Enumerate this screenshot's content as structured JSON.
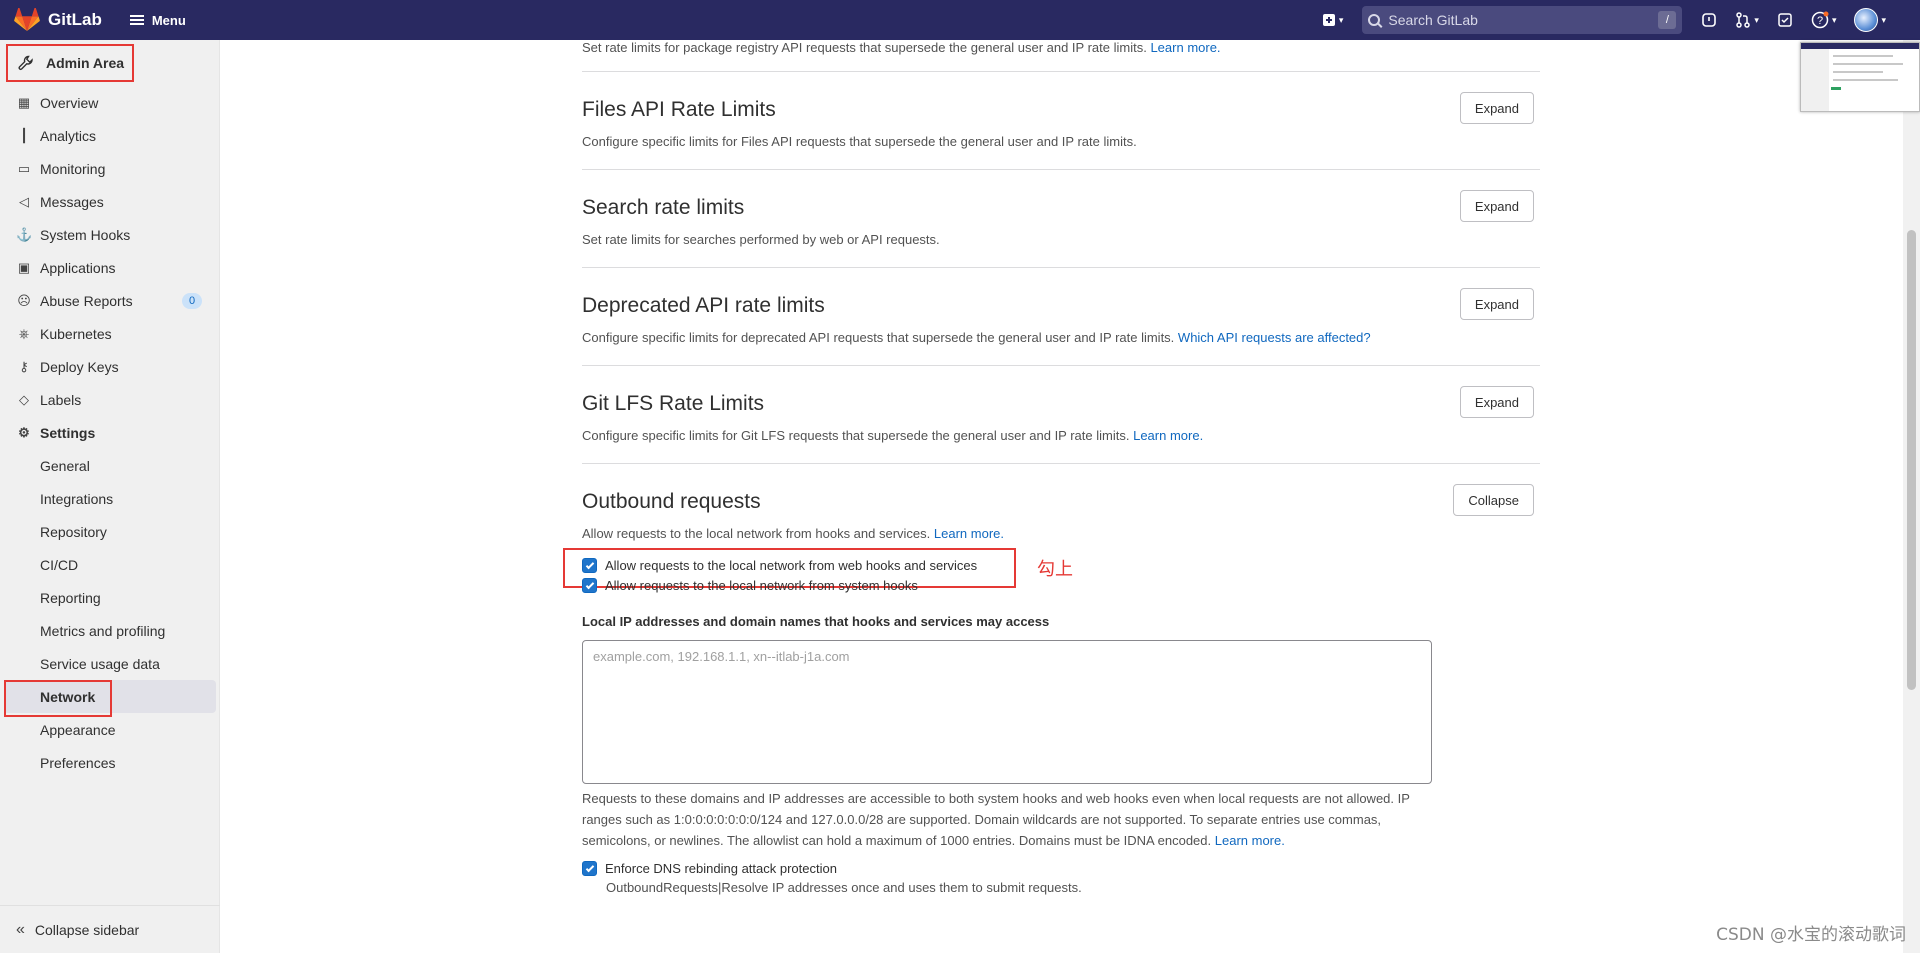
{
  "header": {
    "brand": "GitLab",
    "menu_label": "Menu",
    "search_placeholder": "Search GitLab",
    "search_shortcut": "/",
    "bar_color": "#292961"
  },
  "sidebar": {
    "admin_area_label": "Admin Area",
    "items": [
      {
        "label": "Overview",
        "icon": "overview-icon"
      },
      {
        "label": "Analytics",
        "icon": "chart-icon"
      },
      {
        "label": "Monitoring",
        "icon": "monitor-icon"
      },
      {
        "label": "Messages",
        "icon": "bullhorn-icon"
      },
      {
        "label": "System Hooks",
        "icon": "anchor-icon"
      },
      {
        "label": "Applications",
        "icon": "applications-icon"
      },
      {
        "label": "Abuse Reports",
        "icon": "abuse-icon",
        "badge": "0"
      },
      {
        "label": "Kubernetes",
        "icon": "kubernetes-icon"
      },
      {
        "label": "Deploy Keys",
        "icon": "key-icon"
      },
      {
        "label": "Labels",
        "icon": "label-icon"
      },
      {
        "label": "Settings",
        "icon": "gear-icon"
      }
    ],
    "settings_sub": [
      "General",
      "Integrations",
      "Repository",
      "CI/CD",
      "Reporting",
      "Metrics and profiling",
      "Service usage data",
      "Network",
      "Appearance",
      "Preferences"
    ],
    "active_sub": "Network",
    "collapse_label": "Collapse sidebar"
  },
  "main": {
    "top_desc": "Set rate limits for package registry API requests that supersede the general user and IP rate limits.",
    "learn_more": "Learn more.",
    "sections": [
      {
        "title": "Files API Rate Limits",
        "desc": "Configure specific limits for Files API requests that supersede the general user and IP rate limits.",
        "link": "",
        "button": "Expand"
      },
      {
        "title": "Search rate limits",
        "desc": "Set rate limits for searches performed by web or API requests.",
        "link": "",
        "button": "Expand"
      },
      {
        "title": "Deprecated API rate limits",
        "desc": "Configure specific limits for deprecated API requests that supersede the general user and IP rate limits.",
        "link": "Which API requests are affected?",
        "button": "Expand"
      },
      {
        "title": "Git LFS Rate Limits",
        "desc": "Configure specific limits for Git LFS requests that supersede the general user and IP rate limits.",
        "link": "Learn more.",
        "button": "Expand"
      }
    ],
    "outbound": {
      "title": "Outbound requests",
      "button": "Collapse",
      "desc": "Allow requests to the local network from hooks and services.",
      "link": "Learn more.",
      "chk_web": "Allow requests to the local network from web hooks and services",
      "chk_system": "Allow requests to the local network from system hooks",
      "annotation": "勾上",
      "allowlist_label": "Local IP addresses and domain names that hooks and services may access",
      "allowlist_placeholder": "example.com, 192.168.1.1, xn--itlab-j1a.com",
      "help": "Requests to these domains and IP addresses are accessible to both system hooks and web hooks even when local requests are not allowed. IP ranges such as 1:0:0:0:0:0:0:0/124 and 127.0.0.0/28 are supported. Domain wildcards are not supported. To separate entries use commas, semicolons, or newlines. The allowlist can hold a maximum of 1000 entries. Domains must be IDNA encoded.",
      "help_link": "Learn more.",
      "chk_dns": "Enforce DNS rebinding attack protection",
      "dns_sub": "OutboundRequests|Resolve IP addresses once and uses them to submit requests."
    }
  },
  "watermark": "CSDN @水宝的滚动歌词"
}
